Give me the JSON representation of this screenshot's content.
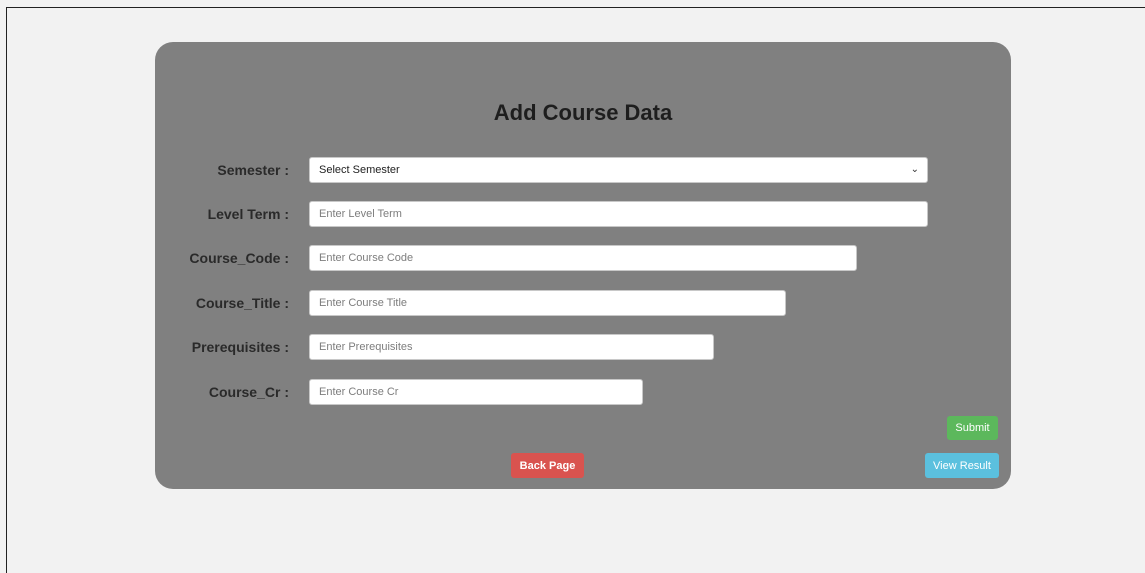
{
  "title": "Add Course Data",
  "fields": {
    "semester": {
      "label": "Semester :",
      "selected": "Select Semester"
    },
    "level_term": {
      "label": "Level Term :",
      "placeholder": "Enter Level Term"
    },
    "course_code": {
      "label": "Course_Code :",
      "placeholder": "Enter Course Code"
    },
    "course_title": {
      "label": "Course_Title :",
      "placeholder": "Enter Course Title"
    },
    "prerequisites": {
      "label": "Prerequisites :",
      "placeholder": "Enter Prerequisites"
    },
    "course_cr": {
      "label": "Course_Cr :",
      "placeholder": "Enter Course Cr"
    }
  },
  "buttons": {
    "submit": "Submit",
    "back": "Back Page",
    "view_result": "View Result"
  },
  "colors": {
    "panel": "#808080",
    "submit": "#5cb85c",
    "back": "#d9534f",
    "view_result": "#5bc0de"
  },
  "icons": {
    "select_caret": "chevron-down-icon"
  }
}
